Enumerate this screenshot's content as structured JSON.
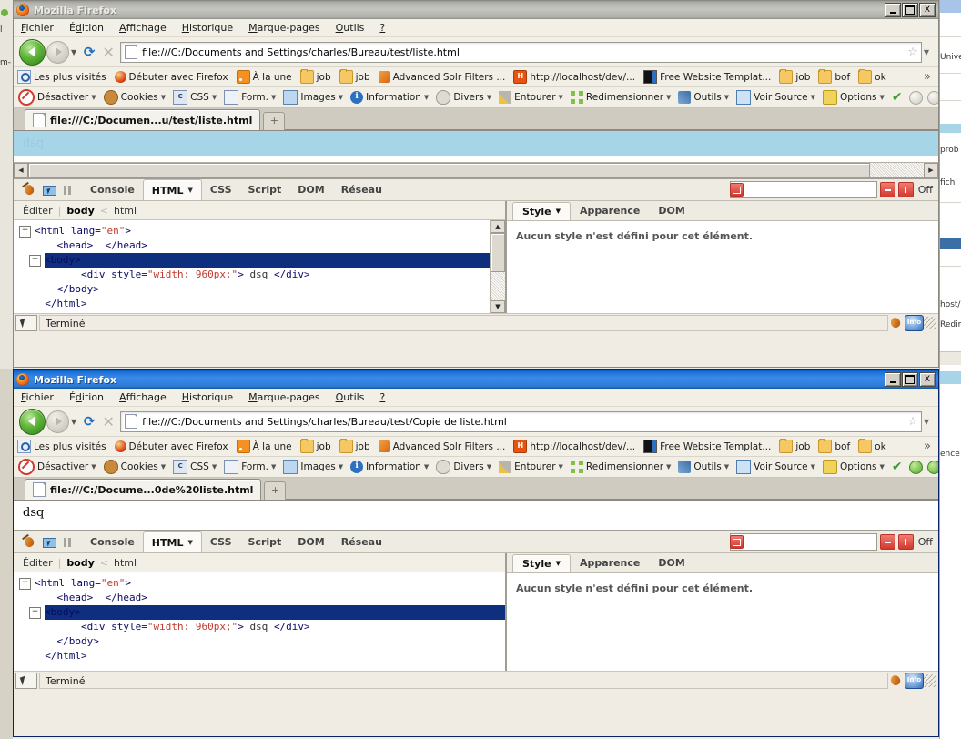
{
  "window1": {
    "title": "Mozilla Firefox",
    "active": false,
    "controls": {
      "minimize": "_",
      "maximize": "□",
      "close": "X"
    },
    "menu": [
      "Fichier",
      "Édition",
      "Affichage",
      "Historique",
      "Marque-pages",
      "Outils",
      "?"
    ],
    "url": "file:///C:/Documents and Settings/charles/Bureau/test/liste.html",
    "tab_title": "file:///C:/Documen...u/test/liste.html",
    "new_tab_label": "+",
    "page_text": "dsq",
    "status_text": "Terminé"
  },
  "window2": {
    "title": "Mozilla Firefox",
    "active": true,
    "controls": {
      "minimize": "_",
      "maximize": "□",
      "close": "X"
    },
    "menu": [
      "Fichier",
      "Édition",
      "Affichage",
      "Historique",
      "Marque-pages",
      "Outils",
      "?"
    ],
    "url": "file:///C:/Documents and Settings/charles/Bureau/test/Copie de liste.html",
    "tab_title": "file:///C:/Docume...0de%20liste.html",
    "new_tab_label": "+",
    "page_text": "dsq",
    "status_text": "Terminé"
  },
  "bookmarks": [
    {
      "label": "Les plus visités",
      "icon": "star-page-icon",
      "kind": "star"
    },
    {
      "label": "Débuter avec Firefox",
      "icon": "firefox-icon",
      "kind": "ffox"
    },
    {
      "label": "À la une",
      "icon": "rss-feed-icon",
      "kind": "rss"
    },
    {
      "label": "job",
      "icon": "folder-icon",
      "kind": "folder"
    },
    {
      "label": "job",
      "icon": "folder-icon",
      "kind": "folder"
    },
    {
      "label": "Advanced Solr Filters ...",
      "icon": "solr-icon",
      "kind": "solr"
    },
    {
      "label": "http://localhost/dev/...",
      "icon": "hamster-icon",
      "kind": "ham"
    },
    {
      "label": "Free Website Templat...",
      "icon": "template-icon",
      "kind": "tmpl"
    },
    {
      "label": "job",
      "icon": "folder-icon",
      "kind": "folder"
    },
    {
      "label": "bof",
      "icon": "folder-icon",
      "kind": "folder"
    },
    {
      "label": "ok",
      "icon": "folder-icon",
      "kind": "folder"
    }
  ],
  "bookmarks_overflow": "»",
  "webdev_toolbar": [
    {
      "label": "Désactiver",
      "icon": "disable-icon",
      "kind": "disable",
      "caret": true
    },
    {
      "label": "Cookies",
      "icon": "cookie-icon",
      "kind": "cookie",
      "caret": true
    },
    {
      "label": "CSS",
      "icon": "css-icon",
      "kind": "css",
      "caret": true
    },
    {
      "label": "Form.",
      "icon": "form-icon",
      "kind": "form",
      "caret": true
    },
    {
      "label": "Images",
      "icon": "images-icon",
      "kind": "img",
      "caret": true
    },
    {
      "label": "Information",
      "icon": "information-icon",
      "kind": "info",
      "caret": true
    },
    {
      "label": "Divers",
      "icon": "misc-icon",
      "kind": "div",
      "caret": true
    },
    {
      "label": "Entourer",
      "icon": "outline-icon",
      "kind": "out",
      "caret": true
    },
    {
      "label": "Redimensionner",
      "icon": "resize-icon",
      "kind": "resize",
      "caret": true
    },
    {
      "label": "Outils",
      "icon": "tools-wrench-icon",
      "kind": "tools",
      "caret": true
    },
    {
      "label": "Voir Source",
      "icon": "view-source-icon",
      "kind": "src",
      "caret": true
    },
    {
      "label": "Options",
      "icon": "options-key-icon",
      "kind": "opt",
      "caret": true
    }
  ],
  "firebug": {
    "tabs": [
      "Console",
      "HTML",
      "CSS",
      "Script",
      "DOM",
      "Réseau"
    ],
    "active_tab": "HTML",
    "search_placeholder": "",
    "search_value": "",
    "off_label": "Off",
    "breadcrumb": {
      "edit_label": "Éditer",
      "separator": "|",
      "current": "body",
      "arrow": "<",
      "parent": "html"
    },
    "code_lines": [
      {
        "twisty": "-",
        "indent": 0,
        "parts": [
          {
            "t": "<html lang=",
            "c": "tag"
          },
          {
            "t": "\"en\"",
            "c": "str"
          },
          {
            "t": ">",
            "c": "tag"
          }
        ]
      },
      {
        "twisty": "",
        "indent": 1,
        "parts": [
          {
            "t": "<head>  </head>",
            "c": "tag"
          }
        ]
      },
      {
        "twisty": "-",
        "indent": 1,
        "selected": true,
        "parts": [
          {
            "t": "<body>",
            "c": "tag"
          }
        ]
      },
      {
        "twisty": "",
        "indent": 2,
        "parts": [
          {
            "t": "<div style=",
            "c": "tag"
          },
          {
            "t": "\"width: 960px;\"",
            "c": "str"
          },
          {
            "t": "> ",
            "c": "tag"
          },
          {
            "t": "dsq ",
            "c": "txt"
          },
          {
            "t": "</div>",
            "c": "tag"
          }
        ]
      },
      {
        "twisty": "",
        "indent": 1,
        "parts": [
          {
            "t": "</body>",
            "c": "tag"
          }
        ]
      },
      {
        "twisty": "",
        "indent": 0,
        "parts": [
          {
            "t": "</html>",
            "c": "tag"
          }
        ]
      }
    ],
    "side_tabs": [
      "Style",
      "Apparence",
      "DOM"
    ],
    "side_active_tab": "Style",
    "side_message": "Aucun style n'est défini pour cet élément."
  },
  "background": {
    "left_text_1": "l",
    "left_text_2": "m-",
    "right_texts": [
      "Univer",
      "prob",
      "fich",
      "host/de",
      "Redim",
      "ence"
    ]
  },
  "colors": {
    "title_active": "#1b6fd8",
    "title_inactive": "#b2b2ac",
    "selection_blue": "#0e2f7d",
    "highlight_cyan": "#a6d5e8",
    "string_red": "#c0392b",
    "tag_blue": "#0a0a64",
    "chrome_bg": "#f2efe7"
  }
}
